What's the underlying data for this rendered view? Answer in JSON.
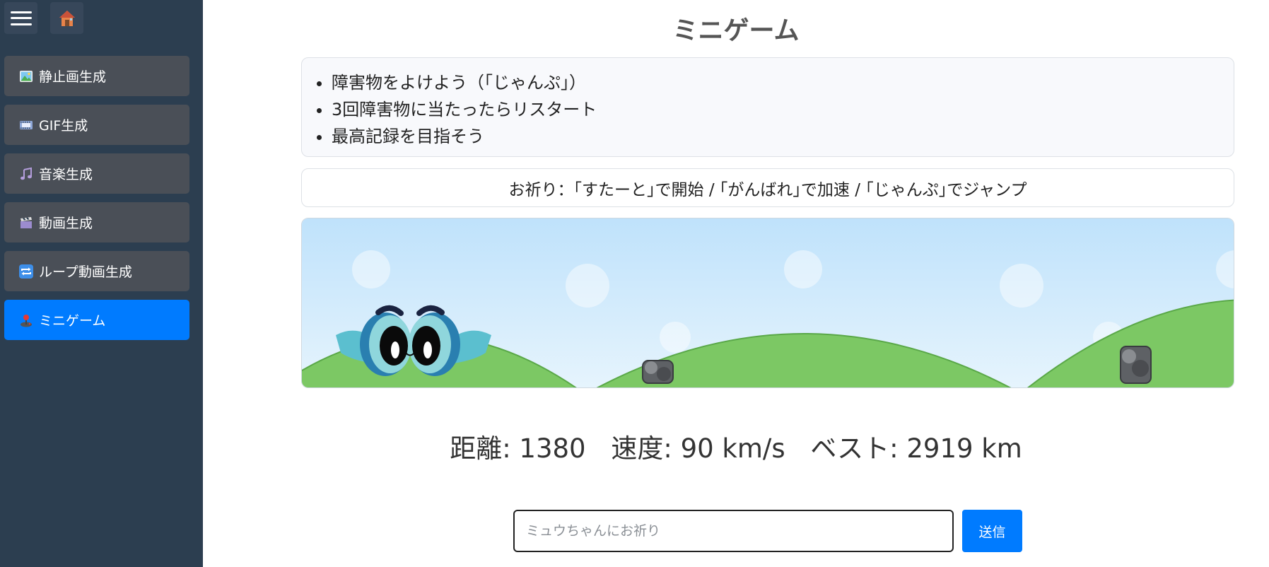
{
  "sidebar": {
    "menu_button_icon": "hamburger-icon",
    "home_button_icon": "house-icon",
    "items": [
      {
        "label": "静止画生成",
        "icon": "picture-icon"
      },
      {
        "label": "GIF生成",
        "icon": "film-icon"
      },
      {
        "label": "音楽生成",
        "icon": "music-note-icon"
      },
      {
        "label": "動画生成",
        "icon": "clapper-icon"
      },
      {
        "label": "ループ動画生成",
        "icon": "repeat-icon"
      },
      {
        "label": "ミニゲーム",
        "icon": "joystick-icon",
        "active": true
      }
    ]
  },
  "main": {
    "title": "ミニゲーム",
    "rules": [
      "障害物をよけよう（｢じゃんぷ｣）",
      "3回障害物に当たったらリスタート",
      "最高記録を目指そう"
    ],
    "prayer_hint": "お祈り：｢すたーと｣で開始 / ｢がんばれ｣で加速 / ｢じゃんぷ｣でジャンプ",
    "stats": {
      "distance": "距離: 1380",
      "speed": "速度: 90 km/s",
      "best": "ベスト: 2919 km"
    },
    "input": {
      "placeholder": "ミュウちゃんにお祈り",
      "value": ""
    },
    "send_label": "送信"
  },
  "colors": {
    "sidebar_bg": "#2c3e50",
    "menu_item_bg": "#4a4f57",
    "active_item": "#007bff",
    "sky": "#bde2fb",
    "grass": "#7cc864",
    "send_button": "#007bff"
  }
}
